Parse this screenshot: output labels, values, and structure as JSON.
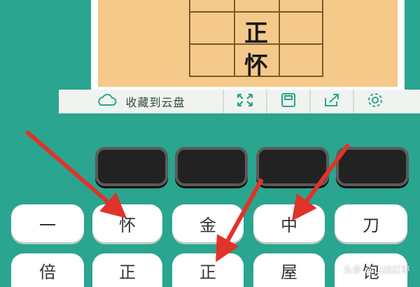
{
  "board": {
    "cells": [
      "正",
      "怀"
    ]
  },
  "toolbar": {
    "cloud_label": "收藏到云盘",
    "icons": [
      "fullscreen-icon",
      "save-icon",
      "share-icon",
      "settings-icon"
    ]
  },
  "keyboard": {
    "row1": [
      "一",
      "怀",
      "金",
      "中",
      "刀"
    ],
    "row2": [
      "倍",
      "正",
      "正",
      "屋",
      "饱"
    ]
  },
  "watermark": "头条 @山过红枣",
  "colors": {
    "background": "#2aa58f",
    "board": "#f4c98a",
    "arrow": "#e0332a",
    "dark_key": "#222222"
  }
}
